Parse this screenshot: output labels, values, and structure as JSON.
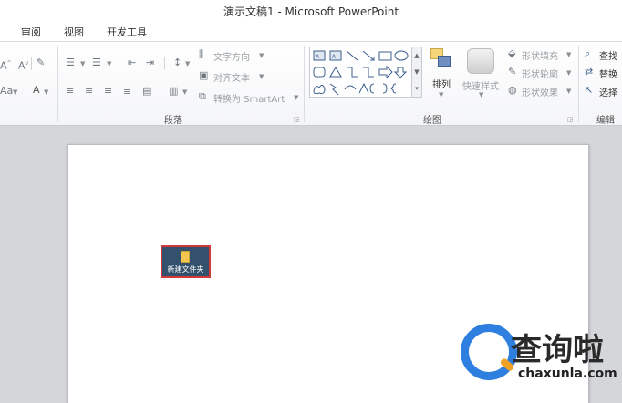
{
  "window": {
    "title": "演示文稿1 - Microsoft PowerPoint"
  },
  "tabs": [
    {
      "label": "审阅"
    },
    {
      "label": "视图"
    },
    {
      "label": "开发工具"
    }
  ],
  "ribbon": {
    "paragraph": {
      "group_label": "段落",
      "text_direction": "文字方向",
      "align_text": "对齐文本",
      "convert_smartart": "转换为 SmartArt"
    },
    "font_partial": {
      "size_label": "Aa"
    },
    "drawing": {
      "group_label": "绘图",
      "arrange": "排列",
      "quick_styles": "快速样式",
      "shape_fill": "形状填充",
      "shape_outline": "形状轮廓",
      "shape_effects": "形状效果"
    },
    "editing": {
      "group_label": "编辑",
      "find": "查找",
      "replace": "替换",
      "select": "选择"
    }
  },
  "slide": {
    "folder_caption": "新建文件夹"
  },
  "watermark": {
    "text": "查询啦",
    "url": "chaxunla.com"
  },
  "colors": {
    "selection_border": "#d23a3a",
    "watermark_blue": "#2f7fe0",
    "watermark_orange": "#f2a124"
  }
}
